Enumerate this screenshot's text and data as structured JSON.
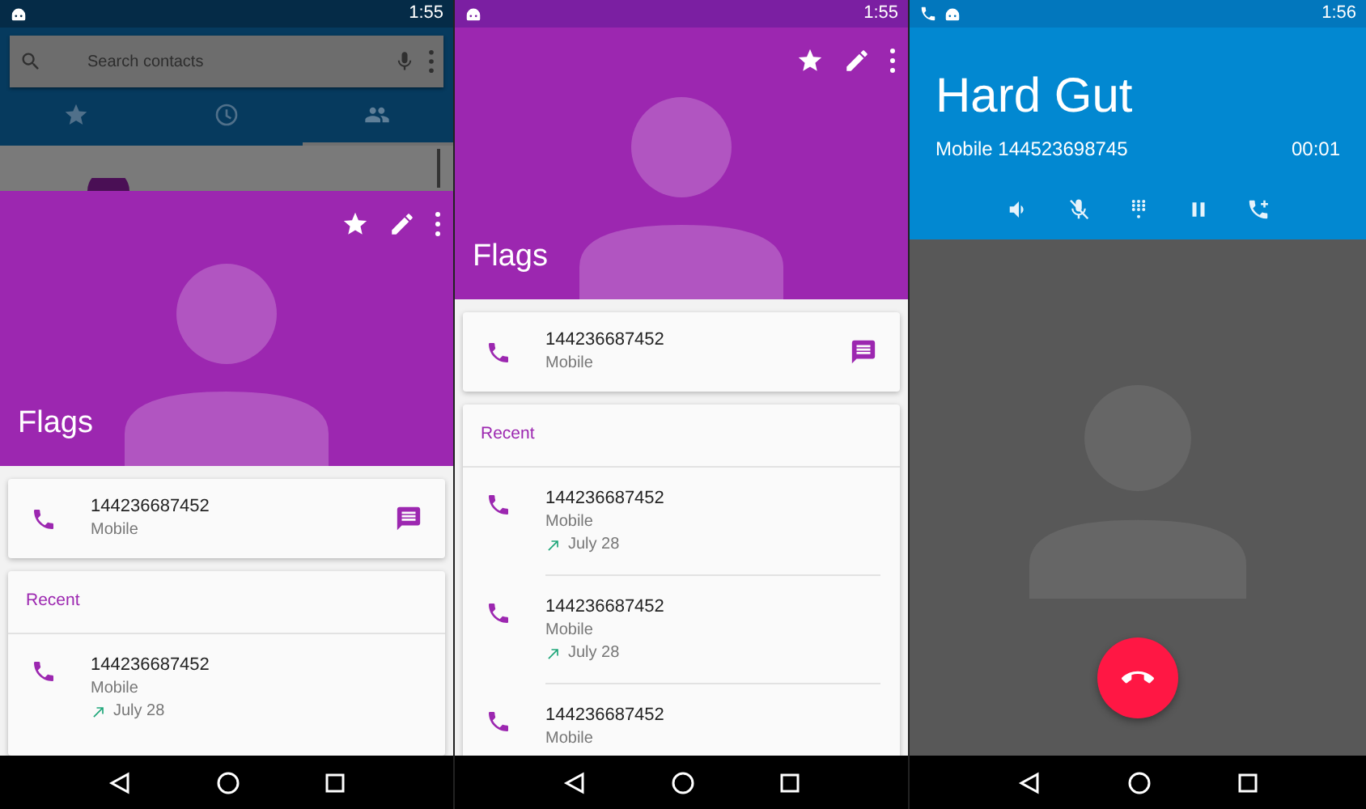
{
  "screens": [
    {
      "kind": "contact",
      "status_bar": {
        "time": "1:55"
      },
      "behind": {
        "search": {
          "placeholder": "Search contacts"
        },
        "tabs": [
          {
            "selected": false
          },
          {
            "selected": false
          },
          {
            "selected": true
          }
        ]
      },
      "contact": {
        "name": "Flags",
        "phone": {
          "number": "144236687452",
          "type": "Mobile"
        },
        "recent_title": "Recent",
        "recent": [
          {
            "number": "144236687452",
            "type": "Mobile",
            "date": "July 28"
          }
        ]
      }
    },
    {
      "kind": "contact",
      "status_bar": {
        "time": "1:55"
      },
      "contact": {
        "name": "Flags",
        "phone": {
          "number": "144236687452",
          "type": "Mobile"
        },
        "recent_title": "Recent",
        "recent": [
          {
            "number": "144236687452",
            "type": "Mobile",
            "date": "July 28"
          },
          {
            "number": "144236687452",
            "type": "Mobile",
            "date": "July 28"
          },
          {
            "number": "144236687452",
            "type": "Mobile"
          }
        ]
      }
    },
    {
      "kind": "call",
      "status_bar": {
        "time": "1:56"
      },
      "caller": "Hard Gut",
      "line": "Mobile 144523698745",
      "duration": "00:01"
    }
  ]
}
